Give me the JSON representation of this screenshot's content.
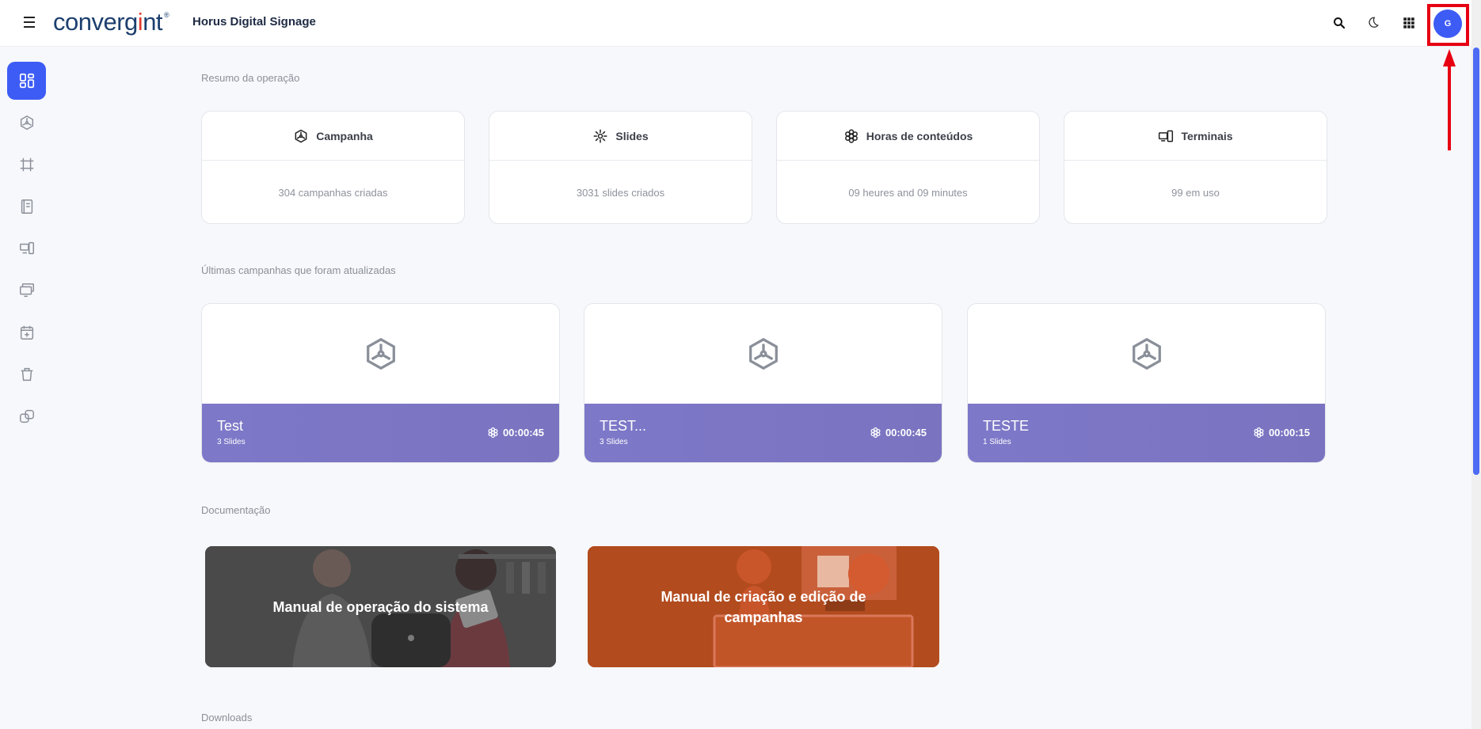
{
  "header": {
    "logo_text_pre": "converg",
    "logo_text_accent": "i",
    "logo_text_post": "nt",
    "logo_tm": "®",
    "app_title": "Horus Digital Signage",
    "avatar_initial": "G"
  },
  "summary": {
    "title": "Resumo da operação",
    "cards": [
      {
        "label": "Campanha",
        "value": "304 campanhas criadas",
        "icon": "campaign-icon"
      },
      {
        "label": "Slides",
        "value": "3031 slides criados",
        "icon": "slides-icon"
      },
      {
        "label": "Horas de conteúdos",
        "value": "09 heures and 09 minutes",
        "icon": "hours-icon"
      },
      {
        "label": "Terminais",
        "value": "99 em uso",
        "icon": "terminals-icon"
      }
    ]
  },
  "campaigns": {
    "title": "Últimas campanhas que foram atualizadas",
    "items": [
      {
        "name": "Test",
        "slides": "3 Slides",
        "duration": "00:00:45"
      },
      {
        "name": "TEST...",
        "slides": "3 Slides",
        "duration": "00:00:45"
      },
      {
        "name": "TESTE",
        "slides": "1 Slides",
        "duration": "00:00:15"
      }
    ]
  },
  "documentation": {
    "title": "Documentação",
    "items": [
      {
        "title": "Manual de operação do sistema"
      },
      {
        "title": "Manual de criação e edição de campanhas"
      }
    ]
  },
  "downloads": {
    "title": "Downloads"
  },
  "colors": {
    "accent": "#3d5cf5",
    "campaign_footer": "#7a73c0",
    "highlight": "#e60012"
  }
}
